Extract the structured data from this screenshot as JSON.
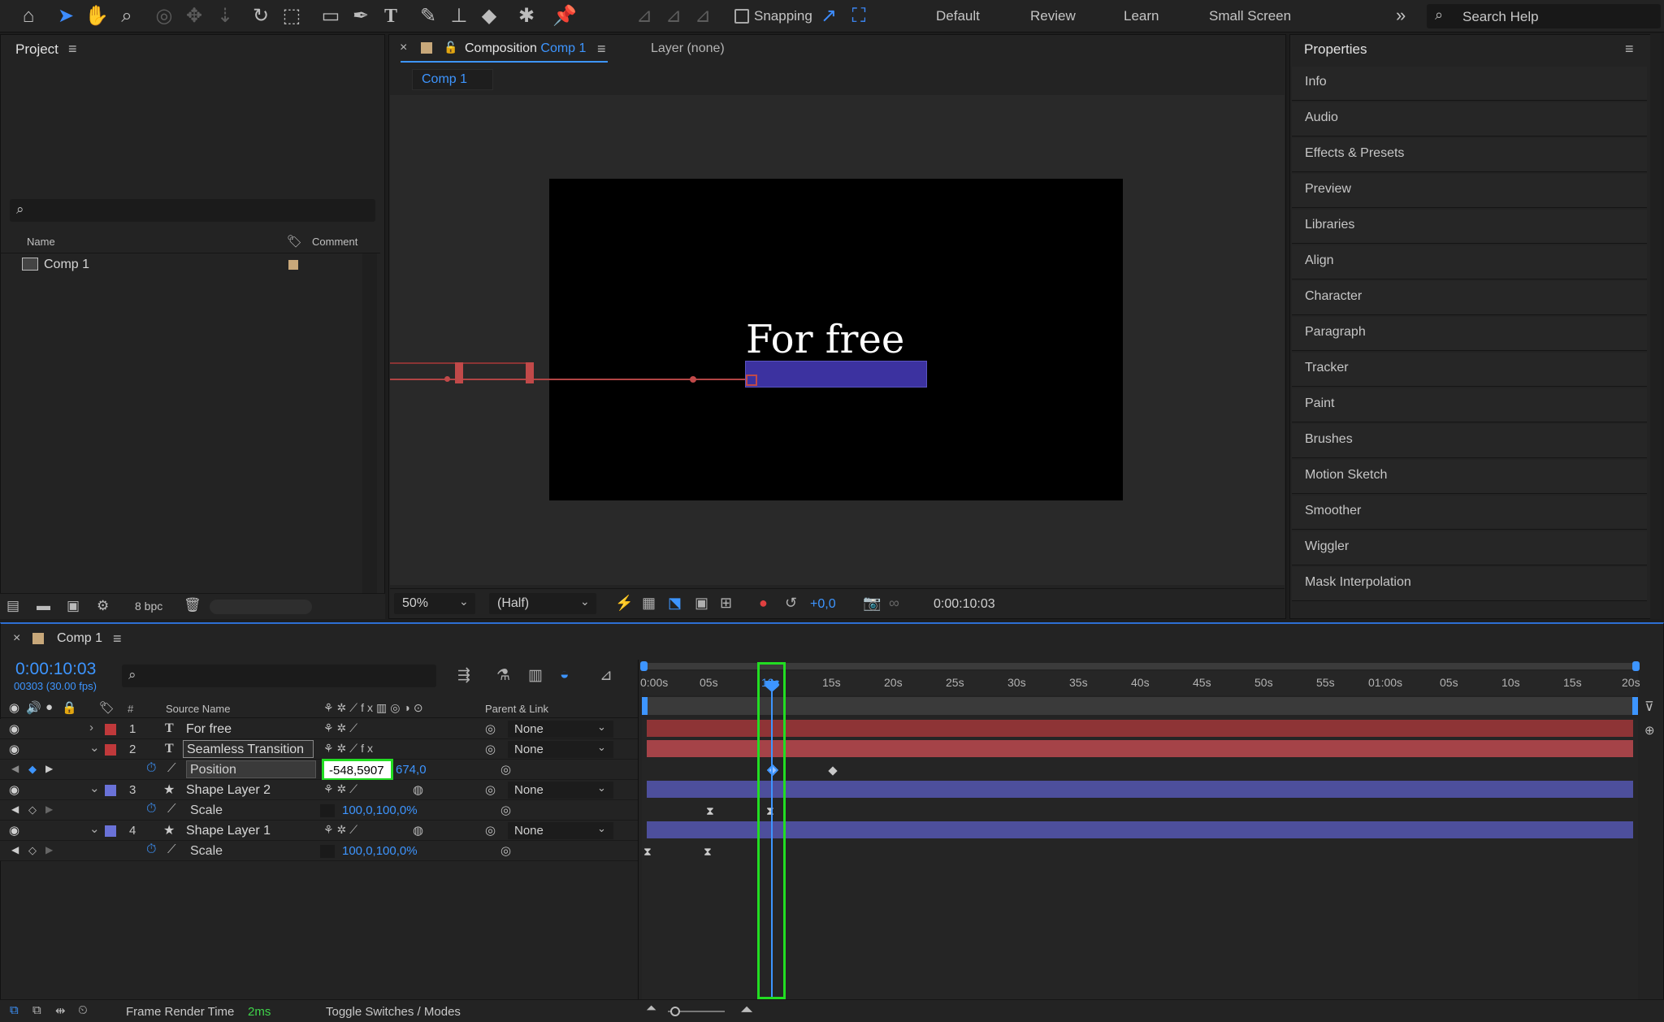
{
  "toolbar": {
    "tools": [
      "home-icon",
      "selection-tool-icon",
      "hand-tool-icon",
      "zoom-tool-icon",
      "orbit-camera-icon",
      "pan-camera-icon",
      "dolly-camera-icon",
      "rotate-tool-icon",
      "pan-behind-icon",
      "rectangle-tool-icon",
      "pen-tool-icon",
      "type-tool-icon",
      "brush-tool-icon",
      "clone-stamp-icon",
      "eraser-tool-icon",
      "roto-brush-icon",
      "puppet-pin-icon"
    ],
    "snapping_label": "Snapping",
    "workspaces": [
      "Default",
      "Review",
      "Learn",
      "Small Screen"
    ],
    "search_placeholder": "Search Help"
  },
  "project": {
    "title": "Project",
    "col_name": "Name",
    "col_comment": "Comment",
    "items": [
      {
        "name": "Comp 1",
        "label_color": "#c8a87a"
      }
    ],
    "bpc": "8 bpc"
  },
  "composition": {
    "tab_prefix": "Composition",
    "tab_comp": "Comp 1",
    "layer_tab": "Layer (none)",
    "breadcrumb": "Comp 1",
    "text_layer": "For free",
    "bar_color": "#3c32a0",
    "zoom": "50%",
    "resolution": "(Half)",
    "exposure": "+0,0",
    "timecode": "0:00:10:03"
  },
  "properties": {
    "title": "Properties",
    "items": [
      "Info",
      "Audio",
      "Effects & Presets",
      "Preview",
      "Libraries",
      "Align",
      "Character",
      "Paragraph",
      "Tracker",
      "Paint",
      "Brushes",
      "Motion Sketch",
      "Smoother",
      "Wiggler",
      "Mask Interpolation"
    ]
  },
  "timeline": {
    "tab": "Comp 1",
    "timecode": "0:00:10:03",
    "frames": "00303 (30.00 fps)",
    "col_num": "#",
    "col_source": "Source Name",
    "col_parent": "Parent & Link",
    "ruler": [
      "0:00s",
      "05s",
      "10s",
      "15s",
      "20s",
      "25s",
      "30s",
      "35s",
      "40s",
      "45s",
      "50s",
      "55s",
      "01:00s",
      "05s",
      "10s",
      "15s",
      "20s"
    ],
    "layers": [
      {
        "num": "1",
        "type": "T",
        "name": "For free",
        "color": "#c0393b",
        "parent": "None",
        "bar_color": "#8e3436"
      },
      {
        "num": "2",
        "type": "T",
        "name": "Seamless Transition",
        "color": "#c0393b",
        "parent": "None",
        "bar_color": "#a54348"
      },
      {
        "num": "3",
        "type": "★",
        "name": "Shape Layer 2",
        "color": "#6a72d8",
        "parent": "None",
        "bar_color": "#4d4f9c"
      },
      {
        "num": "4",
        "type": "★",
        "name": "Shape Layer 1",
        "color": "#6a72d8",
        "parent": "None",
        "bar_color": "#4d4f9c"
      }
    ],
    "position": {
      "label": "Position",
      "x_value": "-548,5907",
      "y_value": "674,0"
    },
    "scale_label": "Scale",
    "scale_value": "100,0,100,0%",
    "footer_render_label": "Frame Render Time",
    "footer_render_value": "2ms",
    "footer_toggle": "Toggle Switches / Modes"
  }
}
